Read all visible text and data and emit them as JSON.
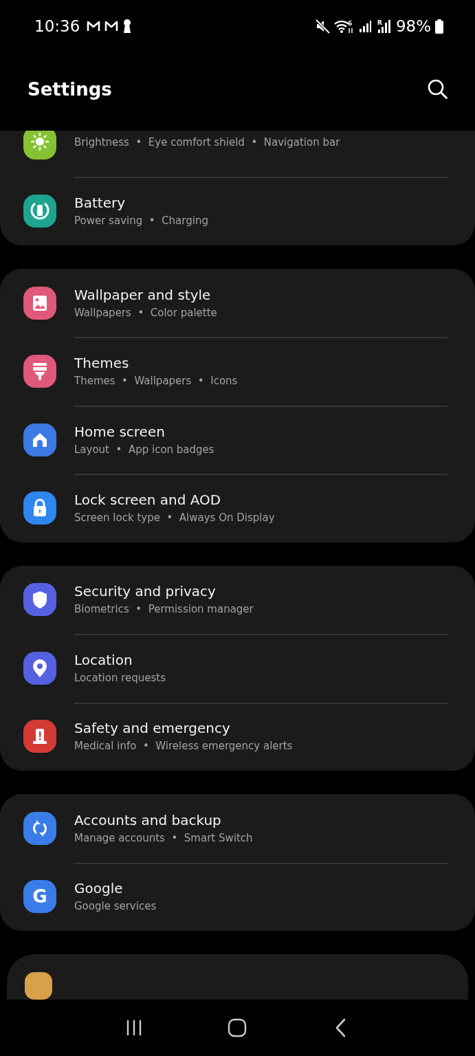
{
  "status_bar": {
    "time": "10:36",
    "wifi_badge": "6",
    "roaming_badge": "R",
    "battery": "98%"
  },
  "header": {
    "title": "Settings"
  },
  "groups": [
    {
      "items": [
        {
          "color": "#86c232",
          "subtitle": "Brightness  •  Eye comfort shield  •  Navigation bar"
        },
        {
          "color": "#1fa58f",
          "title": "Battery",
          "subtitle": "Power saving  •  Charging"
        }
      ]
    },
    {
      "items": [
        {
          "color": "#e0587a",
          "title": "Wallpaper and style",
          "subtitle": "Wallpapers  •  Color palette"
        },
        {
          "color": "#e0587a",
          "title": "Themes",
          "subtitle": "Themes  •  Wallpapers  •  Icons"
        },
        {
          "color": "#3c7be6",
          "title": "Home screen",
          "subtitle": "Layout  •  App icon badges"
        },
        {
          "color": "#2f86ef",
          "title": "Lock screen and AOD",
          "subtitle": "Screen lock type  •  Always On Display"
        }
      ]
    },
    {
      "items": [
        {
          "color": "#5561e0",
          "title": "Security and privacy",
          "subtitle": "Biometrics  •  Permission manager"
        },
        {
          "color": "#5561e0",
          "title": "Location",
          "subtitle": "Location requests"
        },
        {
          "color": "#d53b35",
          "title": "Safety and emergency",
          "subtitle": "Medical info  •  Wireless emergency alerts"
        }
      ]
    },
    {
      "items": [
        {
          "color": "#3b7de8",
          "title": "Accounts and backup",
          "subtitle": "Manage accounts  •  Smart Switch"
        },
        {
          "color": "#3b7de8",
          "icon_text": "G",
          "title": "Google",
          "subtitle": "Google services"
        }
      ]
    }
  ]
}
